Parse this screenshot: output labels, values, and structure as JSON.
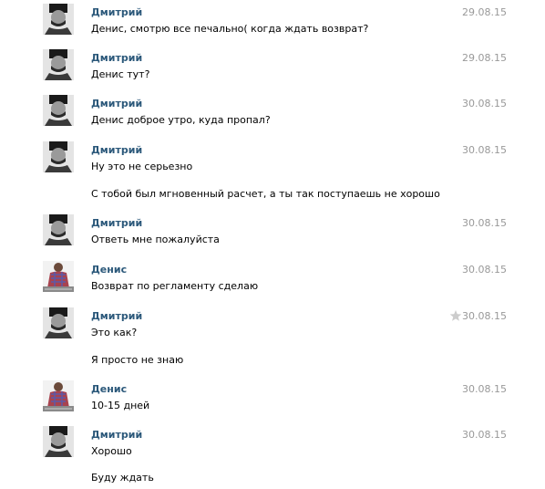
{
  "messages": [
    {
      "author": "Дмитрий",
      "avatar": "dmitry-avatar",
      "date": "29.08.15",
      "lines": [
        "Денис, смотрю все печально( когда ждать возврат?"
      ]
    },
    {
      "author": "Дмитрий",
      "avatar": "dmitry-avatar",
      "date": "29.08.15",
      "lines": [
        "Денис тут?"
      ]
    },
    {
      "author": "Дмитрий",
      "avatar": "dmitry-avatar",
      "date": "30.08.15",
      "lines": [
        "Денис доброе утро, куда пропал?"
      ]
    },
    {
      "author": "Дмитрий",
      "avatar": "dmitry-avatar",
      "date": "30.08.15",
      "lines": [
        "Ну это не серьезно",
        "С тобой был мгновенный расчет, а ты так поступаешь не хорошо"
      ]
    },
    {
      "author": "Дмитрий",
      "avatar": "dmitry-avatar",
      "date": "30.08.15",
      "lines": [
        "Ответь мне пожалуйста"
      ]
    },
    {
      "author": "Денис",
      "avatar": "denis-avatar",
      "date": "30.08.15",
      "lines": [
        "Возврат по регламенту сделаю"
      ]
    },
    {
      "author": "Дмитрий",
      "avatar": "dmitry-avatar",
      "date": "30.08.15",
      "star": true,
      "lines": [
        "Это как?",
        "Я просто не знаю"
      ]
    },
    {
      "author": "Денис",
      "avatar": "denis-avatar",
      "date": "30.08.15",
      "lines": [
        "10-15 дней"
      ]
    },
    {
      "author": "Дмитрий",
      "avatar": "dmitry-avatar",
      "date": "30.08.15",
      "lines": [
        "Хорошо",
        "Буду ждать"
      ]
    }
  ],
  "colors": {
    "author": "#2b587a",
    "date": "#999999",
    "text": "#000000",
    "star": "#cccccc"
  }
}
